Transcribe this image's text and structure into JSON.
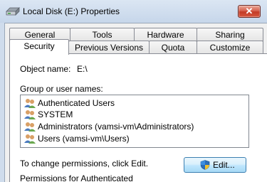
{
  "window": {
    "title": "Local Disk (E:) Properties",
    "close_label": "✕"
  },
  "tabs": {
    "row_back": [
      "General",
      "Tools",
      "Hardware",
      "Sharing"
    ],
    "row_front": [
      "Security",
      "Previous Versions",
      "Quota",
      "Customize"
    ],
    "active": "Security"
  },
  "security": {
    "object_name_label": "Object name:",
    "object_name_value": "E:\\",
    "group_label": "Group or user names:",
    "users": [
      "Authenticated Users",
      "SYSTEM",
      "Administrators (vamsi-vm\\Administrators)",
      "Users (vamsi-vm\\Users)"
    ],
    "change_hint": "To change permissions, click Edit.",
    "edit_label": "Edit...",
    "permissions_for": "Permissions for Authenticated"
  },
  "colors": {
    "titlebar": "#cfdcec",
    "close_button": "#c33a25",
    "selection": "#e3edfa"
  }
}
